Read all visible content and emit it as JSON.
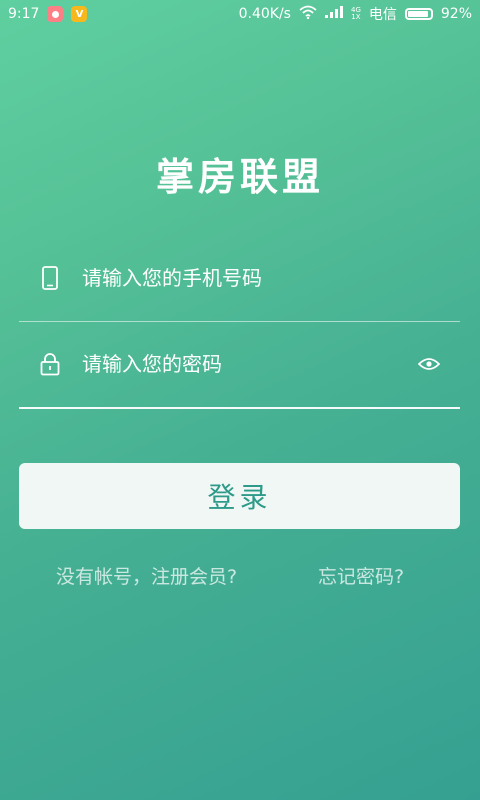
{
  "status_bar": {
    "time": "9:17",
    "app_badge_2": "V",
    "net_speed": "0.40K/s",
    "signal_label": "4G\n1X",
    "carrier": "电信",
    "battery_percent": "92%",
    "battery_level": 0.92
  },
  "app_title": "掌房联盟",
  "phone_field": {
    "value": "",
    "placeholder": "请输入您的手机号码"
  },
  "password_field": {
    "value": "",
    "placeholder": "请输入您的密码"
  },
  "login_button": "登录",
  "register_link": "没有帐号，注册会员?",
  "forgot_link": "忘记密码?",
  "colors": {
    "bg_top": "#5fcfa0",
    "bg_bottom": "#35a091",
    "button_bg": "#f0f7f4",
    "button_text": "#2e9a8a"
  },
  "icons": {
    "phone_field_icon": "smartphone-icon",
    "password_field_icon": "lock-icon",
    "toggle_visibility_icon": "eye-icon",
    "wifi": "wifi-icon",
    "cell_signal": "signal-bars-icon",
    "battery": "battery-icon"
  }
}
